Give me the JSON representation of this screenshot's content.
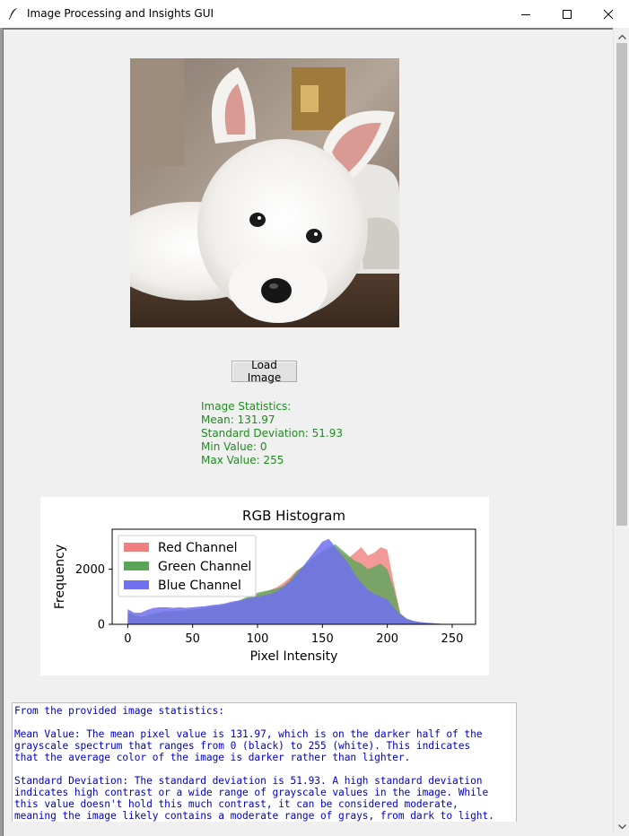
{
  "window": {
    "title": "Image Processing and Insights GUI",
    "icon": "feather-icon",
    "controls": [
      "minimize-icon",
      "maximize-icon",
      "close-icon"
    ]
  },
  "image": {
    "subject": "west-highland-white-terrier-puppy",
    "icon": "dog-photo"
  },
  "load_button": {
    "label": "Load Image"
  },
  "statistics": {
    "header": "Image Statistics:",
    "mean": "Mean: 131.97",
    "std": "Standard Deviation: 51.93",
    "min": "Min Value: 0",
    "max": "Max Value: 255",
    "color": "#1f8a1f"
  },
  "chart_data": {
    "type": "area",
    "title": "RGB Histogram",
    "xlabel": "Pixel Intensity",
    "ylabel": "Frequency",
    "xlim": [
      -12,
      268
    ],
    "ylim": [
      0,
      3450
    ],
    "xticks": [
      0,
      50,
      100,
      150,
      200,
      250
    ],
    "yticks": [
      0,
      2000
    ],
    "legend_position": "upper-left",
    "series": [
      {
        "name": "Red Channel",
        "color": "#f08080",
        "x": [
          0,
          5,
          10,
          15,
          20,
          25,
          30,
          35,
          40,
          45,
          50,
          55,
          60,
          65,
          70,
          75,
          80,
          85,
          90,
          95,
          100,
          105,
          110,
          115,
          120,
          125,
          130,
          135,
          140,
          145,
          150,
          155,
          160,
          165,
          170,
          175,
          180,
          185,
          190,
          195,
          200,
          205,
          210,
          215,
          220,
          225,
          230,
          235,
          240,
          245,
          255
        ],
        "values": [
          400,
          300,
          260,
          300,
          380,
          420,
          460,
          460,
          480,
          500,
          520,
          560,
          600,
          620,
          650,
          700,
          760,
          820,
          900,
          980,
          1080,
          1150,
          1250,
          1350,
          1500,
          1700,
          1950,
          2100,
          2200,
          2400,
          2500,
          2700,
          2750,
          2600,
          2400,
          2600,
          2800,
          2500,
          2600,
          2800,
          2700,
          1500,
          400,
          200,
          120,
          80,
          60,
          40,
          20,
          10,
          0
        ]
      },
      {
        "name": "Green Channel",
        "color": "#5aa55a",
        "x": [
          0,
          5,
          10,
          15,
          20,
          25,
          30,
          35,
          40,
          45,
          50,
          55,
          60,
          65,
          70,
          75,
          80,
          85,
          90,
          95,
          100,
          105,
          110,
          115,
          120,
          125,
          130,
          135,
          140,
          145,
          150,
          155,
          160,
          165,
          170,
          175,
          180,
          185,
          190,
          195,
          200,
          205,
          210,
          215,
          220,
          225,
          230,
          235,
          240,
          245,
          255
        ],
        "values": [
          450,
          320,
          280,
          320,
          400,
          440,
          480,
          480,
          500,
          520,
          540,
          580,
          620,
          640,
          680,
          720,
          780,
          850,
          950,
          1050,
          1150,
          1200,
          1250,
          1300,
          1400,
          1600,
          1900,
          2100,
          2300,
          2500,
          2650,
          2800,
          2900,
          2700,
          2500,
          2300,
          2200,
          2000,
          2100,
          2200,
          2000,
          1300,
          400,
          200,
          120,
          80,
          60,
          40,
          20,
          10,
          0
        ]
      },
      {
        "name": "Blue Channel",
        "color": "#7070f0",
        "x": [
          0,
          5,
          10,
          15,
          20,
          25,
          30,
          35,
          40,
          45,
          50,
          55,
          60,
          65,
          70,
          75,
          80,
          85,
          90,
          95,
          100,
          105,
          110,
          115,
          120,
          125,
          130,
          135,
          140,
          145,
          150,
          155,
          160,
          165,
          170,
          175,
          180,
          185,
          190,
          195,
          200,
          205,
          210,
          215,
          220,
          225,
          230,
          235,
          240,
          245,
          255
        ],
        "values": [
          550,
          420,
          420,
          520,
          600,
          620,
          620,
          600,
          620,
          600,
          620,
          640,
          660,
          700,
          720,
          760,
          820,
          860,
          900,
          960,
          1000,
          1050,
          1100,
          1200,
          1350,
          1550,
          1800,
          2100,
          2400,
          2700,
          3000,
          3100,
          2800,
          2500,
          2200,
          1800,
          1500,
          1250,
          1100,
          1000,
          900,
          600,
          350,
          200,
          120,
          80,
          60,
          40,
          20,
          10,
          0
        ]
      }
    ]
  },
  "insights": {
    "lines": [
      "From the provided image statistics:",
      "",
      "Mean Value: The mean pixel value is 131.97, which is on the darker half of the",
      "grayscale spectrum that ranges from 0 (black) to 255 (white). This indicates",
      "that the average color of the image is darker rather than lighter.",
      "",
      "Standard Deviation: The standard deviation is 51.93. A high standard deviation",
      "indicates high contrast or a wide range of grayscale values in the image. While",
      "this value doesn't hold this much contrast, it can be considered moderate,",
      "meaning the image likely contains a moderate range of grays, from dark to light."
    ],
    "color": "#0000c0"
  }
}
